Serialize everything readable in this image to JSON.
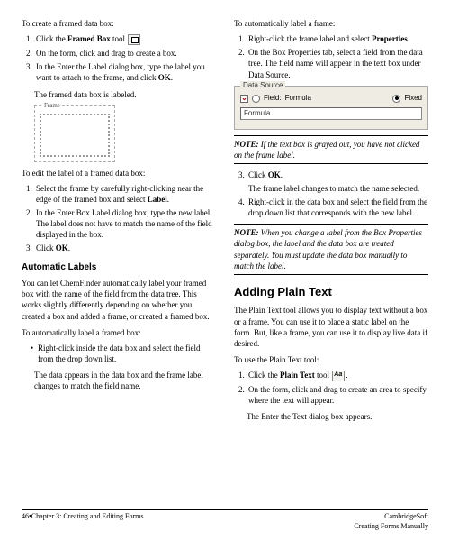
{
  "left": {
    "intro1": "To create a framed data box:",
    "l1_1a": "Click the ",
    "l1_1b": "Framed Box",
    "l1_1c": " tool ",
    "l1_1d": ".",
    "l1_2": "On the form, click and drag to create a box.",
    "l1_3a": "In the Enter the Label dialog box, type the label you want to attach to the frame, and click ",
    "l1_3b": "OK",
    "l1_3c": ".",
    "result1": "The framed data box is labeled.",
    "frame_legend": "Frame",
    "intro2": "To edit the label of a framed data box:",
    "l2_1a": "Select the frame by carefully right-clicking near the edge of the framed box and select ",
    "l2_1b": "Label",
    "l2_1c": ".",
    "l2_2": "In the Enter Box Label dialog box, type the new label. The label does not have to match the name of the field displayed in the box.",
    "l2_3a": "Click ",
    "l2_3b": "OK",
    "l2_3c": ".",
    "h_auto": "Automatic Labels",
    "auto_p": "You can let ChemFinder automatically label your framed box with the name of the field from the data tree. This works slightly differently depending on whether you created a box and added a frame, or created a framed box.",
    "intro3": "To automatically label a framed box:",
    "b1": "Right-click inside the data box and select the field from the drop down list.",
    "b1r": "The data appears in the data box and the frame label changes to match the field name."
  },
  "right": {
    "intro1": "To automatically label a frame:",
    "r1_1a": "Right-click the frame label and select ",
    "r1_1b": "Properties",
    "r1_1c": ".",
    "r1_2": "On the Box Properties tab, select a field from the data tree. The field name will appear in the text box under Data Source.",
    "ds": {
      "legend": "Data Source",
      "field": "Field:",
      "formula_lbl": "Formula",
      "fixed": "Fixed",
      "value": "Formula"
    },
    "note1_nb": "NOTE: ",
    "note1": " If the text box is grayed out, you have not clicked on the frame label.",
    "r1_3a": "Click ",
    "r1_3b": "OK",
    "r1_3c": ".",
    "r1_3r": "The frame label changes to match the name selected.",
    "r1_4": "Right-click in the data box and select the field from the drop down list that corresponds with the new label.",
    "note2_nb": "NOTE: ",
    "note2": " When you change a label from the Box Properties dialog box, the label and the data box are treated separately. You must update the data box manually to match the label.",
    "h_plain": "Adding Plain Text",
    "plain_p": "The Plain Text tool allows you to display text without a box or a frame. You can use it to place a static label on the form. But, like a frame, you can use it to display live data if desired.",
    "intro2": "To use the Plain Text tool:",
    "p1a": "Click the ",
    "p1b": "Plain Text",
    "p1c": " tool ",
    "p1d": ".",
    "p2": "On the form, click and drag to create an area to specify where the text will appear.",
    "p2r": "The Enter the Text dialog box appears."
  },
  "footer": {
    "left": "46•Chapter 3: Creating and Editing Forms",
    "r1": "CambridgeSoft",
    "r2": "Creating Forms Manually"
  }
}
